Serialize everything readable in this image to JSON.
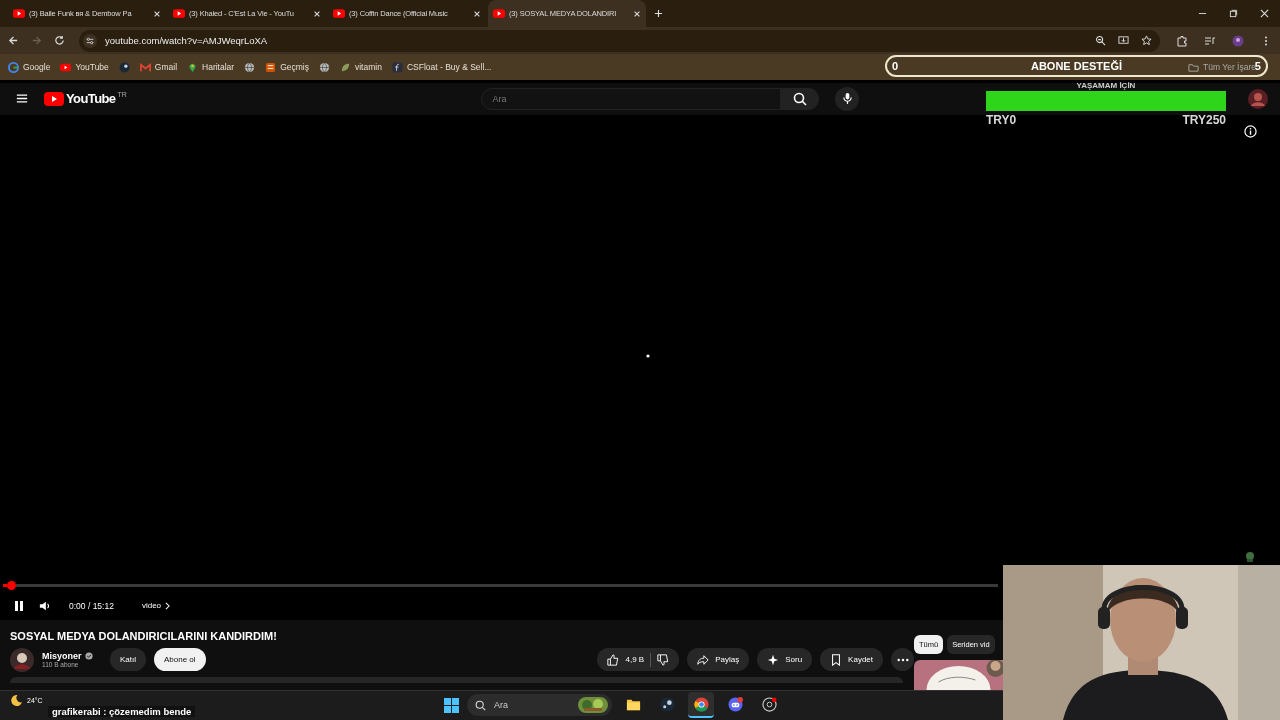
{
  "browser": {
    "tabs": [
      {
        "title": "(3) Baile Funk вя & Dembow Pa",
        "selected": false
      },
      {
        "title": "(3) Khaled - C'Est La Vie - YouTu",
        "selected": false
      },
      {
        "title": "(3) Coffin Dance (Official Music",
        "selected": false
      },
      {
        "title": "(3) SOSYAL MEDYA DOLANDIRI",
        "selected": true
      }
    ],
    "forward_disabled": true,
    "url": "youtube.com/watch?v=AMJWeqrLoXA",
    "bookmarks": [
      {
        "label": "Google",
        "kind": "google"
      },
      {
        "label": "YouTube",
        "kind": "youtube"
      },
      {
        "kind": "steam"
      },
      {
        "label": "Gmail",
        "kind": "gmail"
      },
      {
        "label": "Haritalar",
        "kind": "maps"
      },
      {
        "kind": "globe"
      },
      {
        "label": "Geçmiş",
        "kind": "history"
      },
      {
        "kind": "globe"
      },
      {
        "label": "vitamin",
        "kind": "leaf"
      },
      {
        "label": "CSFloat - Buy & Sell...",
        "kind": "csfloat"
      }
    ],
    "all_bookmarks": "Tüm Yer İşare"
  },
  "subscriber_goal": {
    "start": "0",
    "title": "ABONE DESTEĞİ",
    "end": "5"
  },
  "donation_goal": {
    "title": "YAŞAMAM İÇİN",
    "level": 1,
    "min": "TRY0",
    "max": "TRY250"
  },
  "youtube": {
    "logo": "YouTube",
    "country": "TR",
    "search_placeholder": "Ara",
    "player": {
      "progress": {
        "level": 0.004
      },
      "time": "0:00 / 15:12",
      "chapter": "video"
    },
    "video_title": "SOSYAL MEDYA DOLANDIRICILARINI KANDIRDIM!",
    "channel": {
      "name": "Misyoner",
      "subscribers": "110 B abone",
      "join": "Katıl",
      "subscribe": "Abone ol"
    },
    "actions": {
      "likes": "4,9 B",
      "share": "Paylaş",
      "ask": "Soru",
      "save": "Kaydet"
    },
    "chips": [
      {
        "label": "Tümü",
        "selected": true
      },
      {
        "label": "Seriden vid",
        "selected": false
      }
    ]
  },
  "taskbar": {
    "weather": "24°C",
    "chat": "grafikerabi : çözemedim bende",
    "search_placeholder": "Ara",
    "apps": [
      {
        "kind": "files",
        "active": false
      },
      {
        "kind": "steam",
        "active": false
      },
      {
        "kind": "chrome",
        "active": true
      },
      {
        "kind": "discord",
        "active": false
      },
      {
        "kind": "obs",
        "active": false
      }
    ]
  }
}
